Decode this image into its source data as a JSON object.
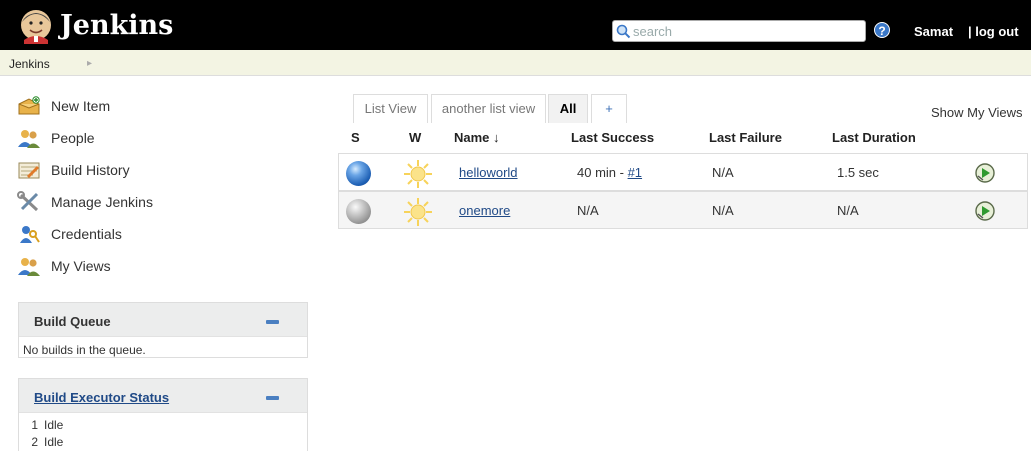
{
  "header": {
    "brand": "Jenkins",
    "search_placeholder": "search",
    "help": "?",
    "user": "Samat",
    "logout": "| log out"
  },
  "breadcrumb": {
    "items": [
      "Jenkins"
    ]
  },
  "sidebar": {
    "tasks": [
      {
        "label": "New Item",
        "icon": "new-item-icon"
      },
      {
        "label": "People",
        "icon": "people-icon"
      },
      {
        "label": "Build History",
        "icon": "build-history-icon"
      },
      {
        "label": "Manage Jenkins",
        "icon": "manage-jenkins-icon"
      },
      {
        "label": "Credentials",
        "icon": "credentials-icon"
      },
      {
        "label": "My Views",
        "icon": "my-views-icon"
      }
    ],
    "build_queue": {
      "title": "Build Queue",
      "empty_text": "No builds in the queue."
    },
    "executors": {
      "title": "Build Executor Status",
      "rows": [
        {
          "num": "1",
          "state": "Idle"
        },
        {
          "num": "2",
          "state": "Idle"
        }
      ]
    }
  },
  "views": {
    "tabs": [
      "List View",
      "another list view",
      "All",
      "+"
    ],
    "active_tab": "All",
    "show_my_views": "Show My Views"
  },
  "table": {
    "headers": {
      "s": "S",
      "w": "W",
      "name": "Name ↓",
      "last_success": "Last Success",
      "last_failure": "Last Failure",
      "last_duration": "Last Duration"
    },
    "rows": [
      {
        "status": "blue",
        "weather": "sunny-icon",
        "name": "helloworld",
        "last_success_text": "40 min - ",
        "last_success_build": "#1",
        "last_failure": "N/A",
        "last_duration": "1.5 sec"
      },
      {
        "status": "grey",
        "weather": "sunny-icon",
        "name": "onemore",
        "last_success_text": "N/A",
        "last_success_build": "",
        "last_failure": "N/A",
        "last_duration": "N/A"
      }
    ]
  },
  "colors": {
    "header_bg": "#000000",
    "breadcrumb_bg": "#f3f4e3",
    "link": "#204a87",
    "status_blue": "#1d5fb4"
  }
}
